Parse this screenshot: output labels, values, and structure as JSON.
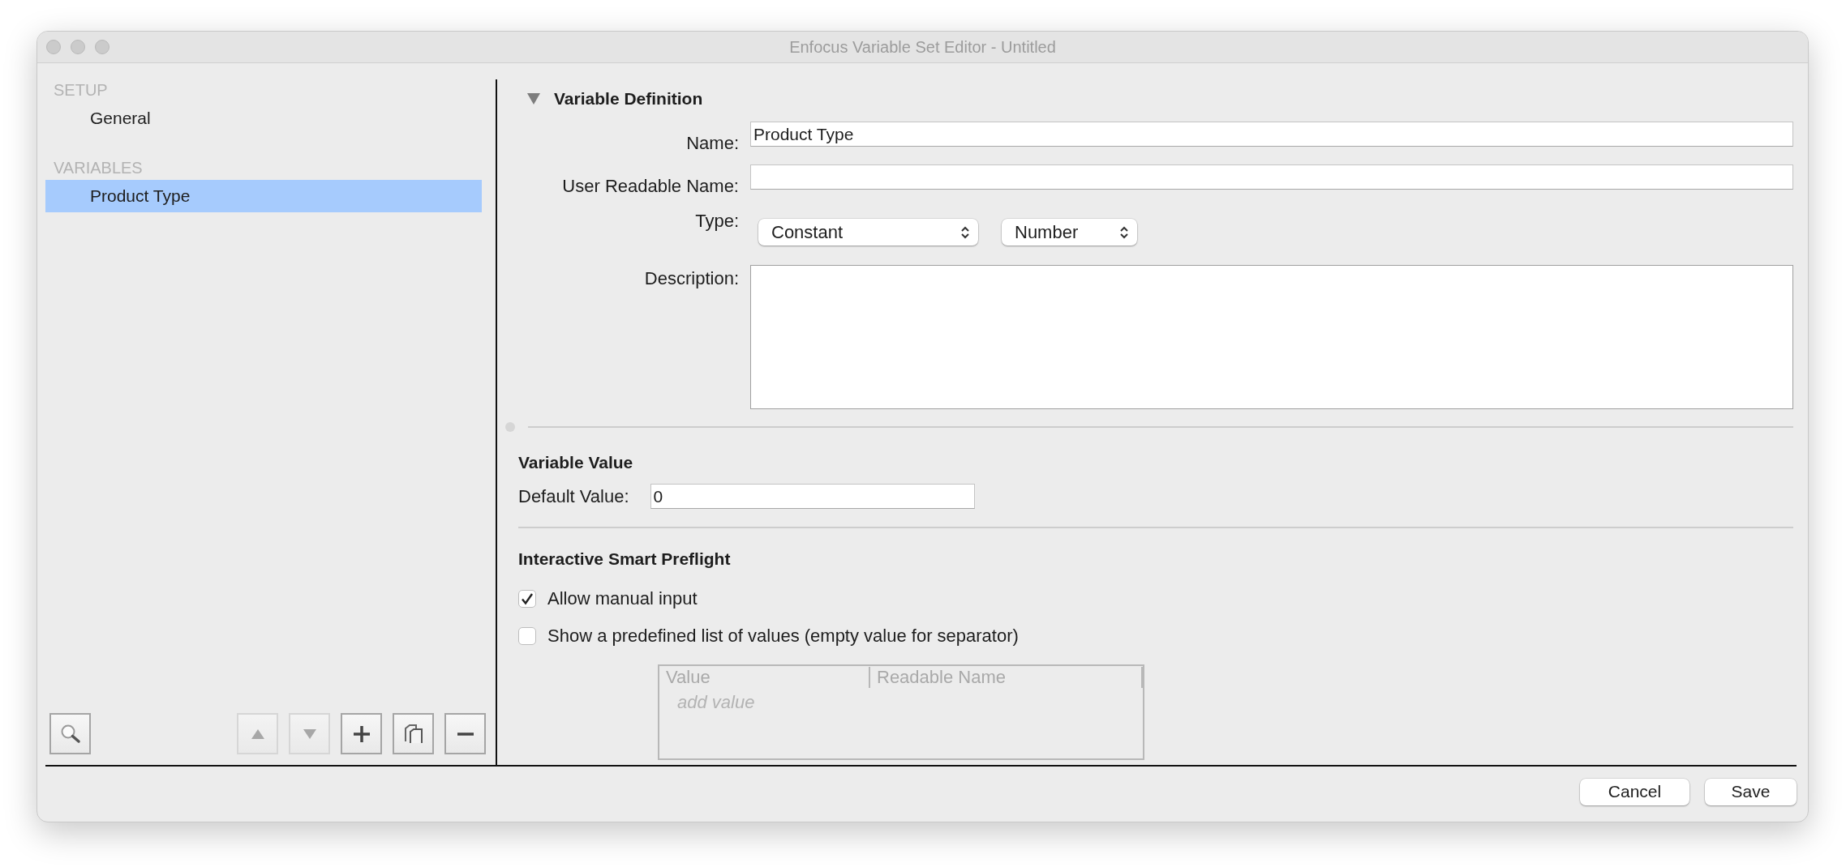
{
  "window": {
    "title": "Enfocus Variable Set Editor - Untitled"
  },
  "sidebar": {
    "sections": [
      {
        "heading": "SETUP",
        "items": [
          {
            "label": "General",
            "selected": false
          }
        ]
      },
      {
        "heading": "VARIABLES",
        "items": [
          {
            "label": "Product Type",
            "selected": true
          }
        ]
      }
    ],
    "toolbar": [
      {
        "kind": "search",
        "disabled": false
      },
      {
        "kind": "up",
        "disabled": true
      },
      {
        "kind": "down",
        "disabled": true
      },
      {
        "kind": "add",
        "disabled": false
      },
      {
        "kind": "duplicate",
        "disabled": false
      },
      {
        "kind": "remove",
        "disabled": false
      }
    ]
  },
  "definition": {
    "title": "Variable Definition",
    "expanded": true,
    "name": {
      "label": "Name:",
      "value": "Product Type"
    },
    "readable_name": {
      "label": "User Readable Name:"
    },
    "type": {
      "label": "Type:",
      "selects": [
        "Constant",
        "Number"
      ]
    },
    "description": {
      "label": "Description:"
    }
  },
  "value": {
    "title": "Variable Value",
    "default": {
      "label": "Default Value:",
      "value": "0"
    }
  },
  "preflight": {
    "title": "Interactive Smart Preflight",
    "options": [
      {
        "label": "Allow manual input",
        "checked": true
      },
      {
        "label": "Show a predefined list of values (empty value for separator)",
        "checked": false
      }
    ],
    "table": {
      "columns": [
        "Value",
        "Readable Name"
      ],
      "placeholder": "add value"
    }
  },
  "buttons": [
    "Cancel",
    "Save"
  ]
}
